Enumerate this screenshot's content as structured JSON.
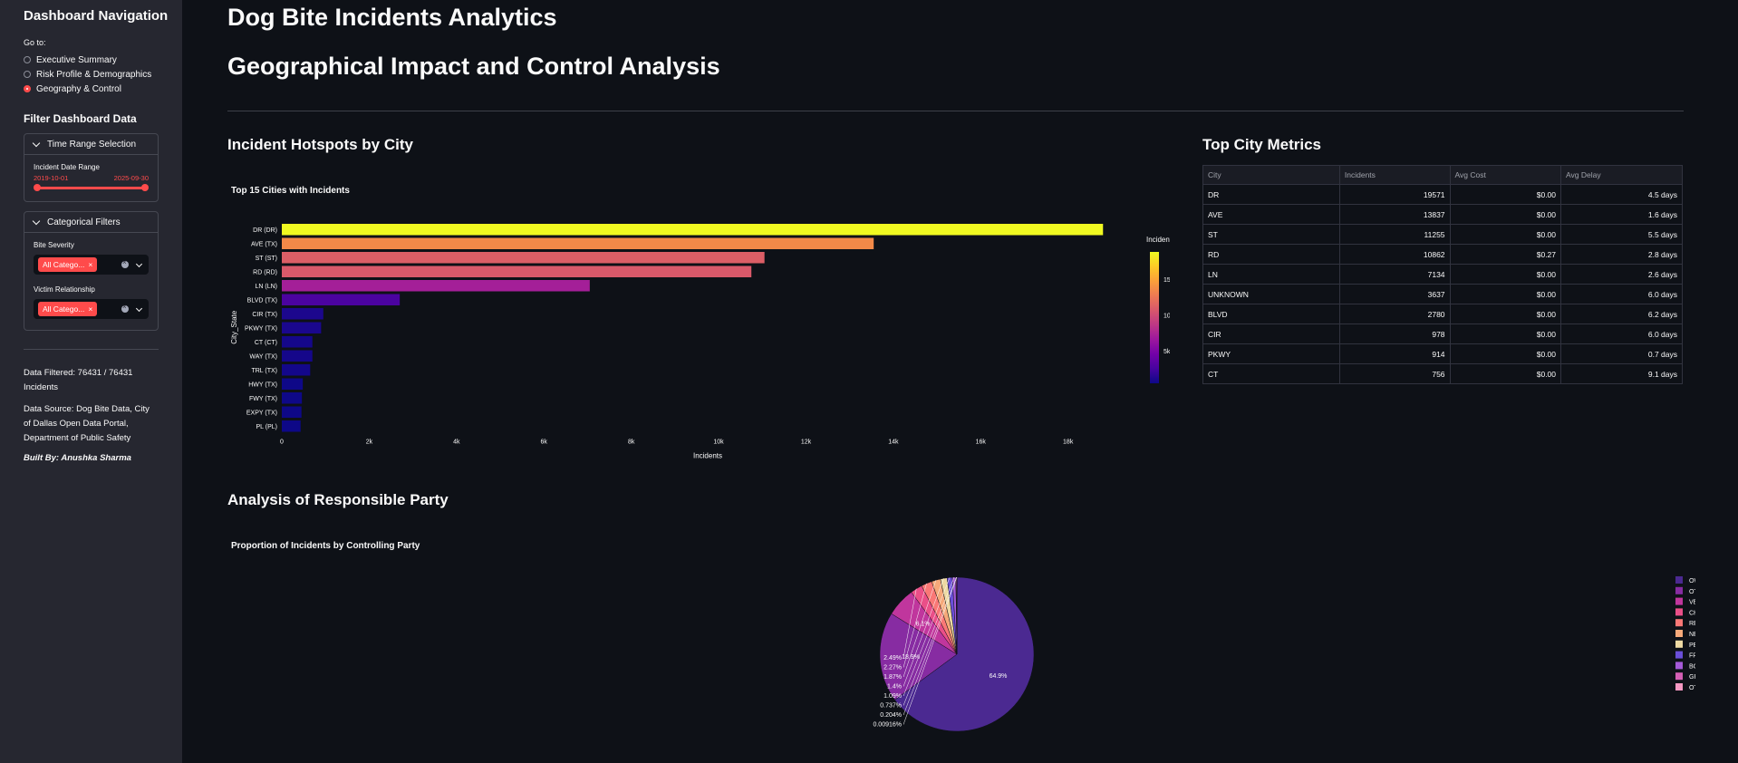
{
  "sidebar": {
    "title": "Dashboard Navigation",
    "goto_label": "Go to:",
    "nav": [
      {
        "label": "Executive Summary",
        "selected": false
      },
      {
        "label": "Risk Profile & Demographics",
        "selected": false
      },
      {
        "label": "Geography & Control",
        "selected": true
      }
    ],
    "filter_title": "Filter Dashboard Data",
    "time_expander": {
      "title": "Time Range Selection",
      "slider_label": "Incident Date Range",
      "start": "2019-10-01",
      "end": "2025-09-30"
    },
    "cat_expander": {
      "title": "Categorical Filters",
      "severity_label": "Bite Severity",
      "severity_tag": "All Catego...",
      "relationship_label": "Victim Relationship",
      "relationship_tag": "All Catego...",
      "tag_remove": "×"
    },
    "data_filtered": "Data Filtered: 76431 / 76431 Incidents",
    "data_source": "Data Source: Dog Bite Data, City of Dallas Open Data Portal, Department of Public Safety",
    "built_by": "Built By: Anushka Sharma"
  },
  "main": {
    "title": "Dog Bite Incidents Analytics",
    "subtitle": "Geographical Impact and Control Analysis",
    "hotspots_heading": "Incident Hotspots by City",
    "metrics_heading": "Top City Metrics",
    "party_heading": "Analysis of Responsible Party"
  },
  "metrics_table": {
    "headers": [
      "City",
      "Incidents",
      "Avg Cost",
      "Avg Delay"
    ],
    "rows": [
      [
        "DR",
        "19571",
        "$0.00",
        "4.5 days"
      ],
      [
        "AVE",
        "13837",
        "$0.00",
        "1.6 days"
      ],
      [
        "ST",
        "11255",
        "$0.00",
        "5.5 days"
      ],
      [
        "RD",
        "10862",
        "$0.27",
        "2.8 days"
      ],
      [
        "LN",
        "7134",
        "$0.00",
        "2.6 days"
      ],
      [
        "UNKNOWN",
        "3637",
        "$0.00",
        "6.0 days"
      ],
      [
        "BLVD",
        "2780",
        "$0.00",
        "6.2 days"
      ],
      [
        "CIR",
        "978",
        "$0.00",
        "6.0 days"
      ],
      [
        "PKWY",
        "914",
        "$0.00",
        "0.7 days"
      ],
      [
        "CT",
        "756",
        "$0.00",
        "9.1 days"
      ]
    ]
  },
  "chart_data": [
    {
      "type": "bar",
      "orientation": "horizontal",
      "title": "Top 15 Cities with Incidents",
      "xlabel": "Incidents",
      "ylabel": "City_State",
      "categories": [
        "DR (DR)",
        "AVE (TX)",
        "ST (ST)",
        "RD (RD)",
        "LN (LN)",
        "BLVD (TX)",
        "CIR (TX)",
        "PKWY (TX)",
        "CT (CT)",
        "WAY (TX)",
        "TRL (TX)",
        "HWY (TX)",
        "FWY (TX)",
        "EXPY (TX)",
        "PL (PL)"
      ],
      "values": [
        18800,
        13550,
        11050,
        10750,
        7050,
        2700,
        950,
        900,
        700,
        700,
        650,
        480,
        460,
        450,
        430
      ],
      "xlim": [
        0,
        19500
      ],
      "xticks": [
        0,
        2000,
        4000,
        6000,
        8000,
        10000,
        12000,
        14000,
        16000,
        18000
      ],
      "xtick_labels": [
        "0",
        "2k",
        "4k",
        "6k",
        "8k",
        "10k",
        "12k",
        "14k",
        "16k",
        "18k"
      ],
      "colorbar": {
        "title": "Incidents",
        "ticks": [
          5000,
          10000,
          15000
        ],
        "tick_labels": [
          "5k",
          "10k",
          "15k"
        ],
        "range": [
          430,
          18800
        ]
      },
      "colorscale": [
        "#0d0887",
        "#46039f",
        "#7201a8",
        "#9c179e",
        "#bd3786",
        "#d8576b",
        "#ed7953",
        "#fb9f3a",
        "#fdca26",
        "#f0f921"
      ]
    },
    {
      "type": "pie",
      "title": "Proportion of Incidents by Controlling Party",
      "labels": [
        "OWNER",
        "OTHER",
        "VET CLINIC",
        "CHILD",
        "RELATIVES",
        "NEIGHBOR",
        "PET SITTER",
        "FRIEND",
        "BOARD FAC",
        "GROOM FAC",
        "OTC"
      ],
      "values": [
        64.9,
        18.9,
        6.1,
        2.49,
        2.27,
        1.87,
        1.4,
        1.09,
        0.737,
        0.204,
        0.00916
      ],
      "text_labels": [
        "64.9%",
        "18.9%",
        "6.1%",
        "2.49%",
        "2.27%",
        "1.87%",
        "1.4%",
        "1.09%",
        "0.737%",
        "0.204%",
        "0.00916%"
      ],
      "colors": [
        "#4b2991",
        "#872ca2",
        "#c0369d",
        "#ea4f88",
        "#fa7876",
        "#f6a97a",
        "#edd9a3",
        "#6a4fd8",
        "#a55ad8",
        "#d45fb4",
        "#f598c2"
      ],
      "legend": "right"
    }
  ]
}
